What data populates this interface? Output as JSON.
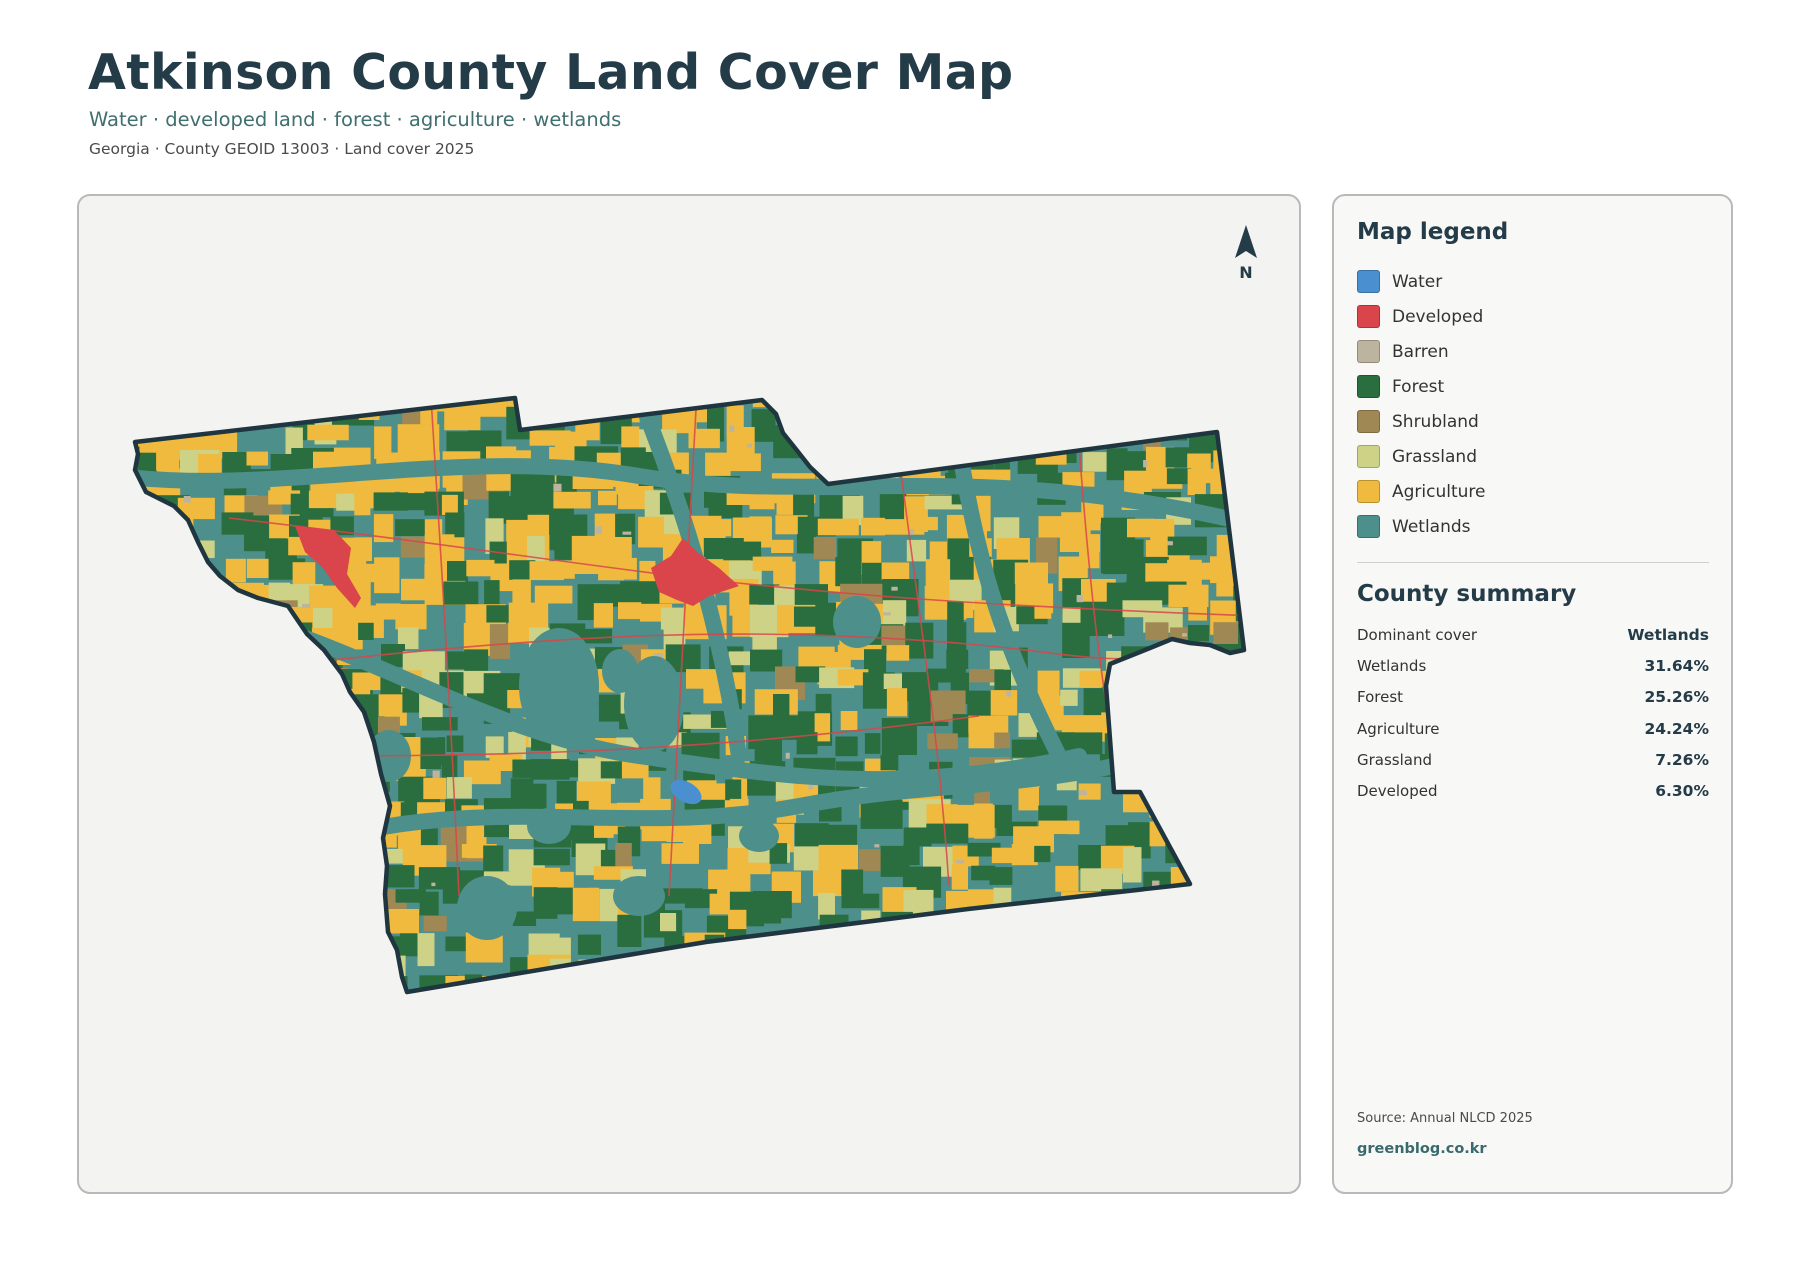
{
  "header": {
    "title": "Atkinson County Land Cover Map",
    "subtitle": "Water · developed land · forest · agriculture · wetlands",
    "meta": "Georgia · County GEOID 13003 · Land cover 2025"
  },
  "map": {
    "north_label": "N",
    "colors": {
      "water": "#4a90d0",
      "developed": "#d9454a",
      "barren": "#bdb49f",
      "forest": "#2a6e3f",
      "shrubland": "#a08855",
      "grassland": "#cdd286",
      "agriculture": "#efba3d",
      "wetlands": "#4d8f8b",
      "outline": "#1f3640",
      "background": "#f3f3f1"
    }
  },
  "legend": {
    "title": "Map legend",
    "items": [
      {
        "label": "Water",
        "color": "#4a90d0"
      },
      {
        "label": "Developed",
        "color": "#d9454a"
      },
      {
        "label": "Barren",
        "color": "#bdb49f"
      },
      {
        "label": "Forest",
        "color": "#2a6e3f"
      },
      {
        "label": "Shrubland",
        "color": "#a08855"
      },
      {
        "label": "Grassland",
        "color": "#cdd286"
      },
      {
        "label": "Agriculture",
        "color": "#efba3d"
      },
      {
        "label": "Wetlands",
        "color": "#4d8f8b"
      }
    ]
  },
  "summary": {
    "title": "County summary",
    "rows": [
      {
        "label": "Dominant cover",
        "value": "Wetlands"
      },
      {
        "label": "Wetlands",
        "value": "31.64%"
      },
      {
        "label": "Forest",
        "value": "25.26%"
      },
      {
        "label": "Agriculture",
        "value": "24.24%"
      },
      {
        "label": "Grassland",
        "value": "7.26%"
      },
      {
        "label": "Developed",
        "value": "6.30%"
      }
    ]
  },
  "footer": {
    "source": "Source: Annual NLCD 2025",
    "site": "greenblog.co.kr"
  }
}
